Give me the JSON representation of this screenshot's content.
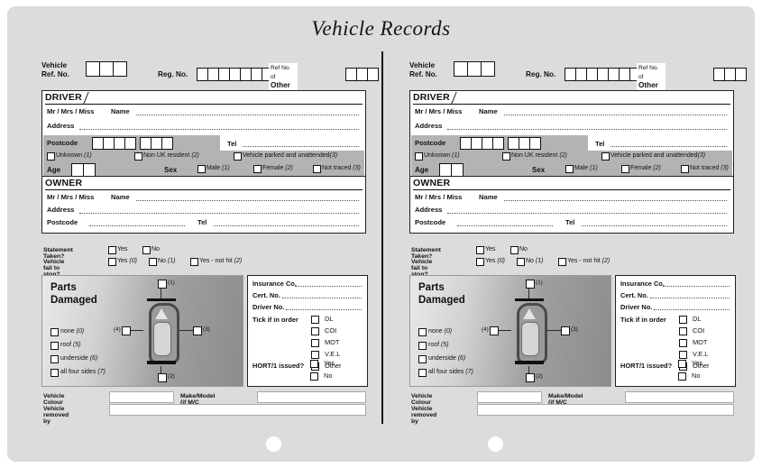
{
  "document": {
    "title": "Vehicle Records"
  },
  "form": {
    "vehicle_ref_label_line1": "Vehicle",
    "vehicle_ref_label_line2": "Ref. No.",
    "vehicle_ref_boxes": 3,
    "reg_no_label": "Reg. No.",
    "reg_no_boxes": 7,
    "other_hit_label_line1": "Ref No. of",
    "other_hit_label_line2": "Other Vehicle Hit",
    "other_hit_boxes": 3,
    "driver": {
      "heading": "DRIVER",
      "title_field": "Mr / Mrs / Miss",
      "name_label": "Name",
      "address_label": "Address",
      "postcode_label": "Postcode",
      "postcode_boxes_first": 4,
      "postcode_boxes_second": 3,
      "tel_label": "Tel",
      "status_options": [
        {
          "label": "Unknown",
          "code": "(1)"
        },
        {
          "label": "Non UK resident",
          "code": "(2)"
        },
        {
          "label": "Vehicle parked and unattended",
          "code": "(3)"
        }
      ],
      "age_label": "Age",
      "age_boxes": 2,
      "sex_label": "Sex",
      "sex_options": [
        {
          "label": "Male",
          "code": "(1)"
        },
        {
          "label": "Female",
          "code": "(2)"
        },
        {
          "label": "Not traced",
          "code": "(3)"
        }
      ]
    },
    "owner": {
      "heading": "OWNER",
      "title_field": "Mr / Mrs / Miss",
      "name_label": "Name",
      "address_label": "Address",
      "postcode_label": "Postcode",
      "tel_label": "Tel"
    },
    "statement": {
      "statement_taken_label": "Statement Taken?",
      "statement_taken_options": [
        {
          "label": "Yes",
          "code": ""
        },
        {
          "label": "No",
          "code": ""
        }
      ],
      "fail_to_stop_label": "Vehicle fail to stop?",
      "fail_to_stop_options": [
        {
          "label": "Yes",
          "code": "(0)"
        },
        {
          "label": "No",
          "code": "(1)"
        },
        {
          "label": "Yes - not hit",
          "code": "(2)"
        }
      ]
    },
    "parts_damaged": {
      "heading_line1": "Parts",
      "heading_line2": "Damaged",
      "diagram_markers": [
        {
          "code": "(1)",
          "position": "front"
        },
        {
          "code": "(2)",
          "position": "rear"
        },
        {
          "code": "(3)",
          "position": "right"
        },
        {
          "code": "(4)",
          "position": "left"
        }
      ],
      "options": [
        {
          "label": "none",
          "code": "(0)"
        },
        {
          "label": "roof",
          "code": "(5)"
        },
        {
          "label": "underside",
          "code": "(6)"
        },
        {
          "label": "all four sides",
          "code": "(7)"
        }
      ]
    },
    "insurance": {
      "company_label": "Insurance Co.",
      "cert_no_label": "Cert. No.",
      "driver_no_label": "Driver No.",
      "tick_label": "Tick if in order",
      "tick_options": [
        "DL",
        "COI",
        "MOT",
        "V.E.L",
        "Other"
      ],
      "hort_label": "HORT/1 issued?",
      "hort_options": [
        "Yes",
        "No"
      ]
    },
    "footer": {
      "vehicle_colour_label": "Vehicle Colour",
      "make_model_label": "Make/Model (if M/C include cc)",
      "vehicle_removed_label": "Vehicle removed by"
    }
  },
  "colors": {
    "page_background": "#dcdcdc",
    "band_gray": "#b3b3b3",
    "ink": "#111111",
    "field_white": "#ffffff"
  }
}
